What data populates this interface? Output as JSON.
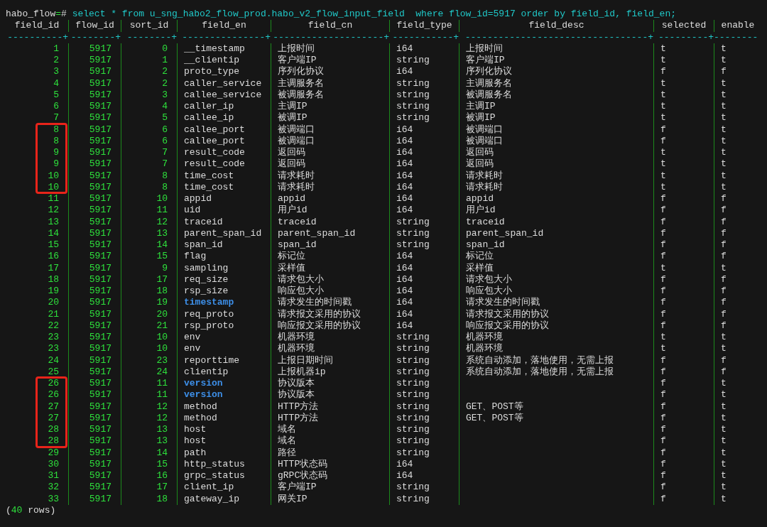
{
  "command_line": [
    {
      "text": "habo_flow",
      "kind": "prompt"
    },
    {
      "text": "=",
      "kind": "accent"
    },
    {
      "text": "# ",
      "kind": "prompt"
    },
    {
      "text": "select * from u_sng_habo2_flow_prod.habo_v2_flow_input_field  where flow_id=5917 order by field_id, field_en;",
      "kind": "query"
    }
  ],
  "columns": [
    {
      "label": "field_id",
      "rule": "----------+"
    },
    {
      "label": "flow_id",
      "rule": "--------+"
    },
    {
      "label": "sort_id",
      "rule": "--------+"
    },
    {
      "label": "field_en",
      "rule": "---------------+"
    },
    {
      "label": "field_cn",
      "rule": "--------------------+"
    },
    {
      "label": "field_type",
      "rule": "-----------+"
    },
    {
      "label": "field_desc",
      "rule": "---------------------------------+"
    },
    {
      "label": "selected",
      "rule": "---------+"
    },
    {
      "label": "enable",
      "rule": "--------"
    }
  ],
  "rows": [
    {
      "field_id": "1",
      "flow_id": "5917",
      "sort_id": "0",
      "field_en": "__timestamp",
      "field_cn": "上报时间",
      "field_type": "i64",
      "field_desc": "上报时间",
      "selected": "t",
      "enable": "t",
      "highlighted": false,
      "boxed": false
    },
    {
      "field_id": "2",
      "flow_id": "5917",
      "sort_id": "1",
      "field_en": "__clientip",
      "field_cn": "客户端IP",
      "field_type": "string",
      "field_desc": "客户端IP",
      "selected": "t",
      "enable": "t",
      "highlighted": false,
      "boxed": false
    },
    {
      "field_id": "3",
      "flow_id": "5917",
      "sort_id": "2",
      "field_en": "proto_type",
      "field_cn": "序列化协议",
      "field_type": "i64",
      "field_desc": "序列化协议",
      "selected": "f",
      "enable": "f",
      "highlighted": false,
      "boxed": false
    },
    {
      "field_id": "4",
      "flow_id": "5917",
      "sort_id": "2",
      "field_en": "caller_service",
      "field_cn": "主调服务名",
      "field_type": "string",
      "field_desc": "主调服务名",
      "selected": "t",
      "enable": "t",
      "highlighted": false,
      "boxed": false
    },
    {
      "field_id": "5",
      "flow_id": "5917",
      "sort_id": "3",
      "field_en": "callee_service",
      "field_cn": "被调服务名",
      "field_type": "string",
      "field_desc": "被调服务名",
      "selected": "t",
      "enable": "t",
      "highlighted": false,
      "boxed": false
    },
    {
      "field_id": "6",
      "flow_id": "5917",
      "sort_id": "4",
      "field_en": "caller_ip",
      "field_cn": "主调IP",
      "field_type": "string",
      "field_desc": "主调IP",
      "selected": "t",
      "enable": "t",
      "highlighted": false,
      "boxed": false
    },
    {
      "field_id": "7",
      "flow_id": "5917",
      "sort_id": "5",
      "field_en": "callee_ip",
      "field_cn": "被调IP",
      "field_type": "string",
      "field_desc": "被调IP",
      "selected": "t",
      "enable": "t",
      "highlighted": false,
      "boxed": false
    },
    {
      "field_id": "8",
      "flow_id": "5917",
      "sort_id": "6",
      "field_en": "callee_port",
      "field_cn": "被调端口",
      "field_type": "i64",
      "field_desc": "被调端口",
      "selected": "f",
      "enable": "t",
      "highlighted": false,
      "boxed": true
    },
    {
      "field_id": "8",
      "flow_id": "5917",
      "sort_id": "6",
      "field_en": "callee_port",
      "field_cn": "被调端口",
      "field_type": "i64",
      "field_desc": "被调端口",
      "selected": "f",
      "enable": "t",
      "highlighted": false,
      "boxed": true
    },
    {
      "field_id": "9",
      "flow_id": "5917",
      "sort_id": "7",
      "field_en": "result_code",
      "field_cn": "返回码",
      "field_type": "i64",
      "field_desc": "返回码",
      "selected": "t",
      "enable": "t",
      "highlighted": false,
      "boxed": true
    },
    {
      "field_id": "9",
      "flow_id": "5917",
      "sort_id": "7",
      "field_en": "result_code",
      "field_cn": "返回码",
      "field_type": "i64",
      "field_desc": "返回码",
      "selected": "t",
      "enable": "t",
      "highlighted": false,
      "boxed": true
    },
    {
      "field_id": "10",
      "flow_id": "5917",
      "sort_id": "8",
      "field_en": "time_cost",
      "field_cn": "请求耗时",
      "field_type": "i64",
      "field_desc": "请求耗时",
      "selected": "t",
      "enable": "t",
      "highlighted": false,
      "boxed": true
    },
    {
      "field_id": "10",
      "flow_id": "5917",
      "sort_id": "8",
      "field_en": "time_cost",
      "field_cn": "请求耗时",
      "field_type": "i64",
      "field_desc": "请求耗时",
      "selected": "t",
      "enable": "t",
      "highlighted": false,
      "boxed": true
    },
    {
      "field_id": "11",
      "flow_id": "5917",
      "sort_id": "10",
      "field_en": "appid",
      "field_cn": "appid",
      "field_type": "i64",
      "field_desc": "appid",
      "selected": "f",
      "enable": "f",
      "highlighted": false,
      "boxed": false
    },
    {
      "field_id": "12",
      "flow_id": "5917",
      "sort_id": "11",
      "field_en": "uid",
      "field_cn": "用户id",
      "field_type": "i64",
      "field_desc": "用户id",
      "selected": "f",
      "enable": "f",
      "highlighted": false,
      "boxed": false
    },
    {
      "field_id": "13",
      "flow_id": "5917",
      "sort_id": "12",
      "field_en": "traceid",
      "field_cn": "traceid",
      "field_type": "string",
      "field_desc": "traceid",
      "selected": "f",
      "enable": "f",
      "highlighted": false,
      "boxed": false
    },
    {
      "field_id": "14",
      "flow_id": "5917",
      "sort_id": "13",
      "field_en": "parent_span_id",
      "field_cn": "parent_span_id",
      "field_type": "string",
      "field_desc": "parent_span_id",
      "selected": "f",
      "enable": "f",
      "highlighted": false,
      "boxed": false
    },
    {
      "field_id": "15",
      "flow_id": "5917",
      "sort_id": "14",
      "field_en": "span_id",
      "field_cn": "span_id",
      "field_type": "string",
      "field_desc": "span_id",
      "selected": "f",
      "enable": "f",
      "highlighted": false,
      "boxed": false
    },
    {
      "field_id": "16",
      "flow_id": "5917",
      "sort_id": "15",
      "field_en": "flag",
      "field_cn": "标记位",
      "field_type": "i64",
      "field_desc": "标记位",
      "selected": "f",
      "enable": "f",
      "highlighted": false,
      "boxed": false
    },
    {
      "field_id": "17",
      "flow_id": "5917",
      "sort_id": "9",
      "field_en": "sampling",
      "field_cn": "采样值",
      "field_type": "i64",
      "field_desc": "采样值",
      "selected": "t",
      "enable": "t",
      "highlighted": false,
      "boxed": false
    },
    {
      "field_id": "18",
      "flow_id": "5917",
      "sort_id": "17",
      "field_en": "req_size",
      "field_cn": "请求包大小",
      "field_type": "i64",
      "field_desc": "请求包大小",
      "selected": "f",
      "enable": "f",
      "highlighted": false,
      "boxed": false
    },
    {
      "field_id": "19",
      "flow_id": "5917",
      "sort_id": "18",
      "field_en": "rsp_size",
      "field_cn": "响应包大小",
      "field_type": "i64",
      "field_desc": "响应包大小",
      "selected": "f",
      "enable": "f",
      "highlighted": false,
      "boxed": false
    },
    {
      "field_id": "20",
      "flow_id": "5917",
      "sort_id": "19",
      "field_en": "timestamp",
      "field_cn": "请求发生的时间戳",
      "field_type": "i64",
      "field_desc": "请求发生的时间戳",
      "selected": "f",
      "enable": "f",
      "highlighted": true,
      "boxed": false
    },
    {
      "field_id": "21",
      "flow_id": "5917",
      "sort_id": "20",
      "field_en": "req_proto",
      "field_cn": "请求报文采用的协议",
      "field_type": "i64",
      "field_desc": "请求报文采用的协议",
      "selected": "f",
      "enable": "f",
      "highlighted": false,
      "boxed": false
    },
    {
      "field_id": "22",
      "flow_id": "5917",
      "sort_id": "21",
      "field_en": "rsp_proto",
      "field_cn": "响应报文采用的协议",
      "field_type": "i64",
      "field_desc": "响应报文采用的协议",
      "selected": "f",
      "enable": "f",
      "highlighted": false,
      "boxed": false
    },
    {
      "field_id": "23",
      "flow_id": "5917",
      "sort_id": "10",
      "field_en": "env",
      "field_cn": "机器环境",
      "field_type": "string",
      "field_desc": "机器环境",
      "selected": "t",
      "enable": "t",
      "highlighted": false,
      "boxed": false
    },
    {
      "field_id": "23",
      "flow_id": "5917",
      "sort_id": "10",
      "field_en": "env",
      "field_cn": "机器环境",
      "field_type": "string",
      "field_desc": "机器环境",
      "selected": "t",
      "enable": "t",
      "highlighted": false,
      "boxed": false
    },
    {
      "field_id": "24",
      "flow_id": "5917",
      "sort_id": "23",
      "field_en": "reporttime",
      "field_cn": "上报日期时间",
      "field_type": "string",
      "field_desc": "系统自动添加，落地使用，无需上报",
      "selected": "f",
      "enable": "f",
      "highlighted": false,
      "boxed": false
    },
    {
      "field_id": "25",
      "flow_id": "5917",
      "sort_id": "24",
      "field_en": "clientip",
      "field_cn": "上报机器ip",
      "field_type": "string",
      "field_desc": "系统自动添加，落地使用，无需上报",
      "selected": "f",
      "enable": "f",
      "highlighted": false,
      "boxed": false
    },
    {
      "field_id": "26",
      "flow_id": "5917",
      "sort_id": "11",
      "field_en": "version",
      "field_cn": "协议版本",
      "field_type": "string",
      "selected": "f",
      "enable": "t",
      "highlighted": true,
      "boxed": true
    },
    {
      "field_id": "26",
      "flow_id": "5917",
      "sort_id": "11",
      "field_en": "version",
      "field_cn": "协议版本",
      "field_type": "string",
      "selected": "f",
      "enable": "t",
      "highlighted": true,
      "boxed": true
    },
    {
      "field_id": "27",
      "flow_id": "5917",
      "sort_id": "12",
      "field_en": "method",
      "field_cn": "HTTP方法",
      "field_type": "string",
      "field_desc": "GET、POST等",
      "selected": "f",
      "enable": "t",
      "highlighted": false,
      "boxed": true
    },
    {
      "field_id": "27",
      "flow_id": "5917",
      "sort_id": "12",
      "field_en": "method",
      "field_cn": "HTTP方法",
      "field_type": "string",
      "field_desc": "GET、POST等",
      "selected": "f",
      "enable": "t",
      "highlighted": false,
      "boxed": true
    },
    {
      "field_id": "28",
      "flow_id": "5917",
      "sort_id": "13",
      "field_en": "host",
      "field_cn": "域名",
      "field_type": "string",
      "selected": "f",
      "enable": "t",
      "highlighted": false,
      "boxed": true
    },
    {
      "field_id": "28",
      "flow_id": "5917",
      "sort_id": "13",
      "field_en": "host",
      "field_cn": "域名",
      "field_type": "string",
      "selected": "f",
      "enable": "t",
      "highlighted": false,
      "boxed": true
    },
    {
      "field_id": "29",
      "flow_id": "5917",
      "sort_id": "14",
      "field_en": "path",
      "field_cn": "路径",
      "field_type": "string",
      "selected": "f",
      "enable": "t",
      "highlighted": false,
      "boxed": false
    },
    {
      "field_id": "30",
      "flow_id": "5917",
      "sort_id": "15",
      "field_en": "http_status",
      "field_cn": "HTTP状态码",
      "field_type": "i64",
      "selected": "f",
      "enable": "t",
      "highlighted": false,
      "boxed": false
    },
    {
      "field_id": "31",
      "flow_id": "5917",
      "sort_id": "16",
      "field_en": "grpc_status",
      "field_cn": "gRPC状态码",
      "field_type": "i64",
      "selected": "f",
      "enable": "t",
      "highlighted": false,
      "boxed": false
    },
    {
      "field_id": "32",
      "flow_id": "5917",
      "sort_id": "17",
      "field_en": "client_ip",
      "field_cn": "客户端IP",
      "field_type": "string",
      "selected": "f",
      "enable": "t",
      "highlighted": false,
      "boxed": false
    },
    {
      "field_id": "33",
      "flow_id": "5917",
      "sort_id": "18",
      "field_en": "gateway_ip",
      "field_cn": "网关IP",
      "field_type": "string",
      "selected": "f",
      "enable": "t",
      "highlighted": false,
      "boxed": false
    }
  ],
  "footer": [
    {
      "text": "(",
      "kind": "plain"
    },
    {
      "text": "40",
      "kind": "accent"
    },
    {
      "text": " rows)",
      "kind": "plain"
    }
  ]
}
